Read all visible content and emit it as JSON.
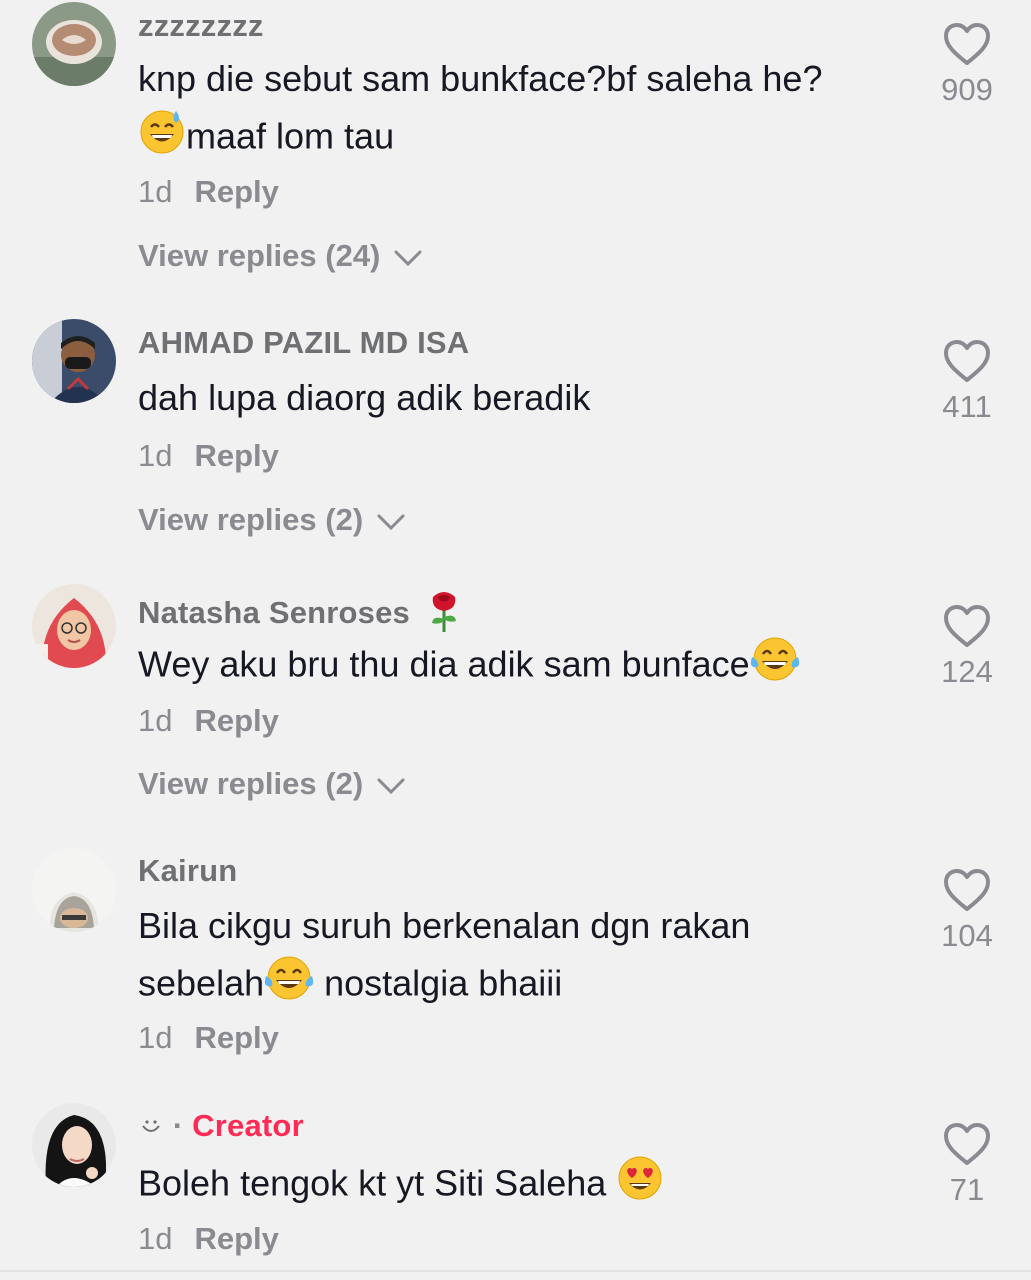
{
  "comments": [
    {
      "username": "zzzzzzzz",
      "text_line1": "knp die sebut sam bunkface?bf saleha he?",
      "text_line2": "maaf lom tau",
      "time": "1d",
      "reply_label": "Reply",
      "view_replies": "View replies (24)",
      "likes": "909"
    },
    {
      "username": "AHMAD PAZIL MD ISA",
      "text_line1": "dah lupa diaorg adik beradik",
      "time": "1d",
      "reply_label": "Reply",
      "view_replies": "View replies (2)",
      "likes": "411"
    },
    {
      "username": "Natasha Senroses",
      "text_line1": "Wey aku bru thu dia adik sam bunface",
      "time": "1d",
      "reply_label": "Reply",
      "view_replies": "View replies (2)",
      "likes": "124"
    },
    {
      "username": "Kairun",
      "text_line1": "Bila cikgu suruh berkenalan dgn rakan",
      "text_line2a": "sebelah",
      "text_line2b": " nostalgia bhaiii",
      "time": "1d",
      "reply_label": "Reply",
      "likes": "104"
    },
    {
      "username": "· ",
      "creator_label": "Creator",
      "text_line1": "Boleh tengok kt yt Siti Saleha ",
      "time": "1d",
      "reply_label": "Reply",
      "likes": "71"
    }
  ],
  "colors": {
    "creator": "#fe2c55",
    "secondary_text": "#8a8b91",
    "background": "#f1f1f1"
  }
}
